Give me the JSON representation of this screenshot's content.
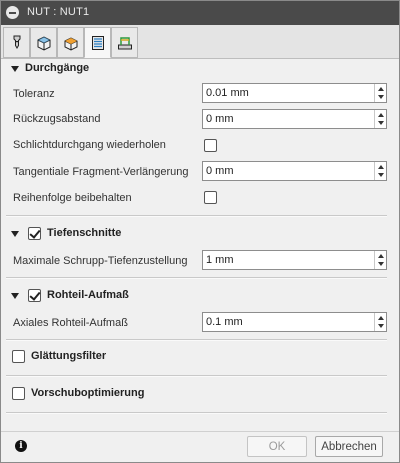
{
  "window": {
    "title": "NUT : NUT1"
  },
  "tabs": [
    {
      "icon": "tool-icon"
    },
    {
      "icon": "geometry-icon"
    },
    {
      "icon": "heights-icon"
    },
    {
      "icon": "passes-icon"
    },
    {
      "icon": "linking-icon"
    }
  ],
  "active_tab_index": 3,
  "sections": {
    "durchgaenge": {
      "title": "Durchgänge",
      "toleranz_label": "Toleranz",
      "toleranz_value": "0.01 mm",
      "rueckzug_label": "Rückzugsabstand",
      "rueckzug_value": "0 mm",
      "schlicht_label": "Schlichtdurchgang wiederholen",
      "schlicht_checked": false,
      "tangential_label": "Tangentiale Fragment-Verlängerung",
      "tangential_value": "0 mm",
      "reihenfolge_label": "Reihenfolge beibehalten",
      "reihenfolge_checked": false
    },
    "tiefenschnitte": {
      "title": "Tiefenschnitte",
      "checked": true,
      "max_label": "Maximale Schrupp-Tiefenzustellung",
      "max_value": "1 mm"
    },
    "rohteil": {
      "title": "Rohteil-Aufmaß",
      "checked": true,
      "axial_label": "Axiales Rohteil-Aufmaß",
      "axial_value": "0.1 mm"
    },
    "glaettung": {
      "title": "Glättungsfilter",
      "checked": false
    },
    "vorschub": {
      "title": "Vorschuboptimierung",
      "checked": false
    }
  },
  "footer": {
    "ok_label": "OK",
    "cancel_label": "Abbrechen",
    "info_icon": "info-icon"
  }
}
